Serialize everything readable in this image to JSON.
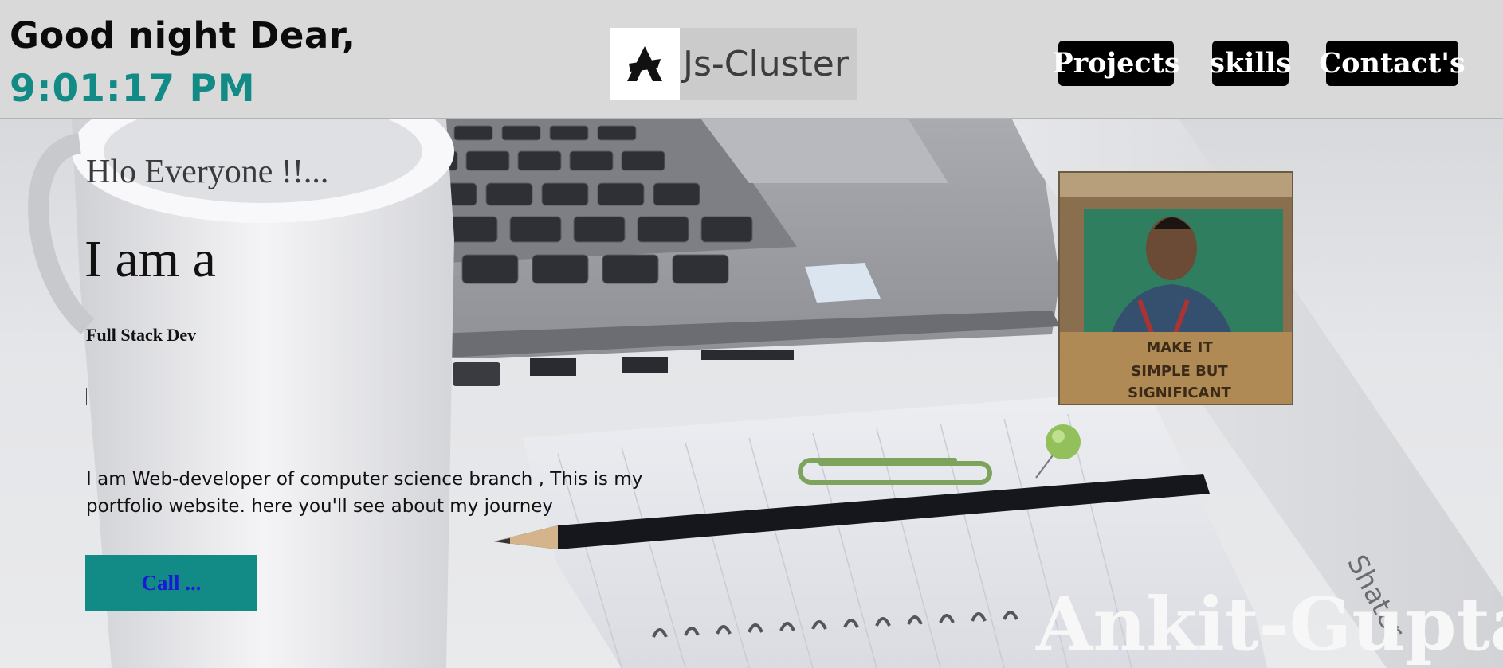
{
  "header": {
    "greeting": "Good night Dear,",
    "time": "9:01:17 PM",
    "logo": {
      "text": "Js-Cluster",
      "icon": "logo-mark-icon"
    },
    "nav": [
      {
        "label": "Projects"
      },
      {
        "label": "skills"
      },
      {
        "label": "Contact's"
      }
    ]
  },
  "hero": {
    "intro": "Hlo Everyone !!...",
    "iam": "I am a",
    "role": "Full Stack Dev",
    "bio": "I am Web-developer of computer science branch , This is my portfolio website. here you'll see about my journey",
    "call_button": "Call ...",
    "profile_caption": [
      "MAKE IT",
      "SIMPLE BUT",
      "SIGNIFICANT"
    ],
    "signature": "Ankit-Gupta",
    "background_text": "Shater"
  },
  "colors": {
    "accent": "#128a86",
    "header_bg": "#d9d9d9",
    "nav_bg": "#000000",
    "call_text": "#1a1ad6"
  }
}
